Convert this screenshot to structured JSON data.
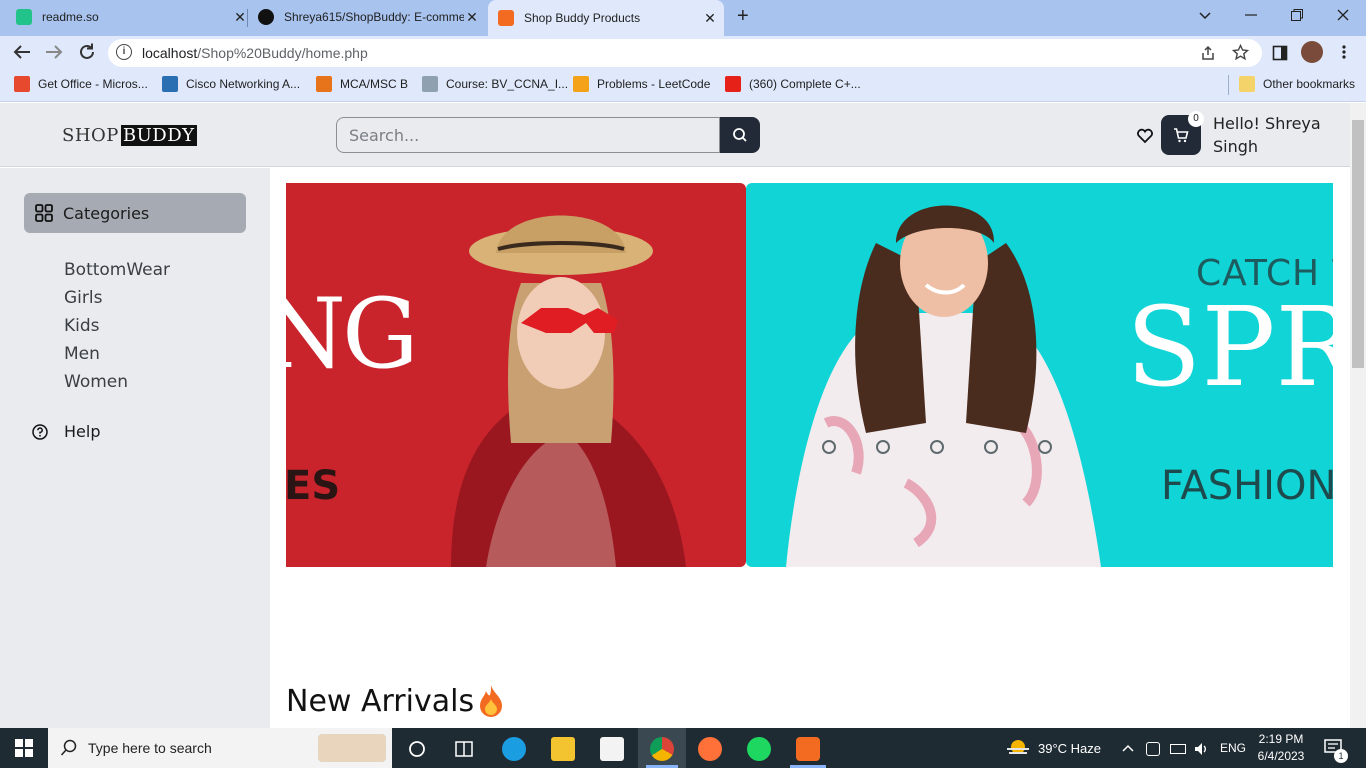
{
  "browser": {
    "tabs": [
      {
        "title": "readme.so",
        "favicon_color": "#22c38a",
        "active": false
      },
      {
        "title": "Shreya615/ShopBuddy: E-comme",
        "favicon_color": "#111111",
        "active": false
      },
      {
        "title": "Shop Buddy Products",
        "favicon_color": "#f26b21",
        "active": true
      }
    ],
    "close_glyph": "✕",
    "new_tab_glyph": "+",
    "url_host": "localhost",
    "url_path": "/Shop%20Buddy/home.php",
    "bookmarks": [
      {
        "label": "Get Office - Micros...",
        "icon_color": "#e6492d"
      },
      {
        "label": "Cisco Networking A...",
        "icon_color": "#2b6fb3"
      },
      {
        "label": "MCA/MSC B",
        "icon_color": "#e7731a"
      },
      {
        "label": "Course: BV_CCNA_I...",
        "icon_color": "#8fa0b0"
      },
      {
        "label": "Problems - LeetCode",
        "icon_color": "#f5a21b"
      },
      {
        "label": "(360) Complete C+...",
        "icon_color": "#e62117"
      }
    ],
    "other_bookmarks": "Other bookmarks"
  },
  "site": {
    "logo_light": "SHOP",
    "logo_bold": "BUDDY",
    "search_placeholder": "Search...",
    "cart_count": "0",
    "greeting": "Hello! Shreya Singh",
    "sidebar": {
      "categories_label": "Categories",
      "items": [
        "BottomWear",
        "Girls",
        "Kids",
        "Men",
        "Women"
      ],
      "help_label": "Help"
    },
    "carousel": {
      "slide1_text_top": "NG",
      "slide1_text_bottom": "ES",
      "slide2_line1": "CATCH THE",
      "slide2_line2": "SPRIN",
      "slide2_line3": "FASHION VI",
      "dot_count": 5
    },
    "new_arrivals": "New Arrivals"
  },
  "taskbar": {
    "search_text": "Type here to search",
    "weather": "39°C  Haze",
    "language": "ENG",
    "time": "2:19 PM",
    "date": "6/4/2023",
    "notification_count": "1"
  },
  "colors": {
    "accent_dark": "#212a36",
    "chrome_tab_bg": "#a8c3ee",
    "chrome_bar_bg": "#dfe9fb",
    "slide1_bg": "#c9242c",
    "slide2_bg": "#11d4d6"
  }
}
